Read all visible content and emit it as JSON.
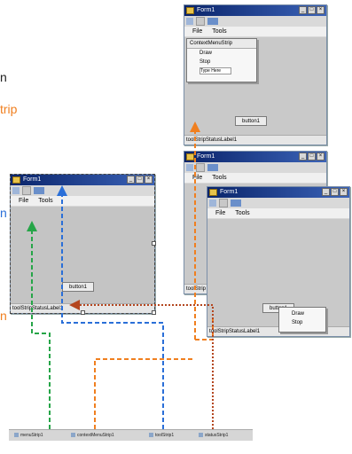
{
  "captions": {
    "top_fragment_1": "n",
    "top_fragment_2": "trip",
    "mid_fragment_1": "n",
    "mid_fragment_2": "n"
  },
  "colors": {
    "orange": "#f07f1f",
    "blue": "#2a6fd8",
    "green": "#26a548",
    "dotted": "#b4461f",
    "titlebar": "#0a246a"
  },
  "window_common": {
    "title": "Form1",
    "menu_file": "File",
    "menu_tools": "Tools",
    "button_label": "button1",
    "status_label": "toolStripStatusLabel1",
    "caption_buttons": [
      "_",
      "□",
      "×"
    ]
  },
  "context_menu": {
    "strip_name": "ContextMenuStrip",
    "items": [
      "Draw",
      "Stop"
    ],
    "type_here": "Type Here"
  },
  "status_truncated": "toolStrip",
  "tray_items": [
    {
      "label": "menuStrip1",
      "icon": "menustrip-icon"
    },
    {
      "label": "contextMenuStrip1",
      "icon": "contextmenu-icon"
    },
    {
      "label": "toolStrip1",
      "icon": "toolstrip-icon"
    },
    {
      "label": "statusStrip1",
      "icon": "statusstrip-icon"
    }
  ]
}
